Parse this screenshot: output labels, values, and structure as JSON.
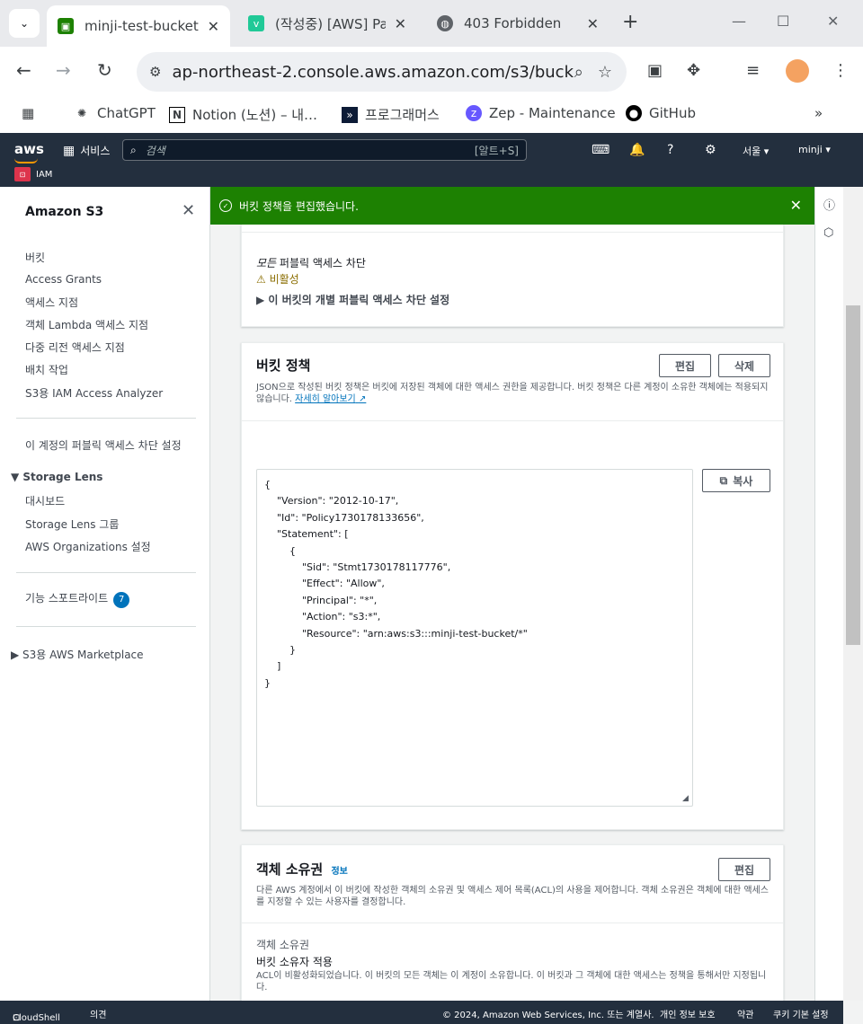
{
  "browser": {
    "tabs": [
      {
        "title": "minji-test-bucket -",
        "favicon_color": "#1d8102"
      },
      {
        "title": "(작성중) [AWS] Pa",
        "favicon_color": "#20c997",
        "favicon_letter": "v"
      },
      {
        "title": "403 Forbidden",
        "favicon_color": "#5f6368"
      }
    ],
    "url": "ap-northeast-2.console.aws.amazon.com/s3/buck…",
    "bookmarks": [
      "ChatGPT",
      "Notion (노션) – 내…",
      "프로그래머스",
      "Zep - Maintenance",
      "GitHub"
    ]
  },
  "aws_header": {
    "logo": "aws",
    "services_label": "서비스",
    "search_placeholder": "검색",
    "search_shortcut": "[알트+S]",
    "region": "서울 ▾",
    "user": "minji ▾",
    "favorite": "IAM"
  },
  "sidebar": {
    "title": "Amazon S3",
    "items": [
      "버킷",
      "Access Grants",
      "액세스 지점",
      "객체 Lambda 액세스 지점",
      "다중 리전 액세스 지점",
      "배치 작업",
      "S3용 IAM Access Analyzer"
    ],
    "public_block": "이 계정의 퍼블릭 액세스 차단 설정",
    "storage_lens": {
      "title": "Storage Lens",
      "items": [
        "대시보드",
        "Storage Lens 그룹",
        "AWS Organizations 설정"
      ]
    },
    "feature_spotlight": "기능 스포트라이트",
    "feature_count": "7",
    "marketplace": "S3용 AWS Marketplace"
  },
  "flash": {
    "message": "버킷 정책을 편집했습니다.",
    "color": "#1d8102"
  },
  "public_access": {
    "label_italic": "모든",
    "label_rest": " 퍼블릭 액세스 차단",
    "status": "비활성",
    "expand_label": "이 버킷의 개별 퍼블릭 액세스 차단 설정"
  },
  "bucket_policy": {
    "title": "버킷 정책",
    "edit": "편집",
    "delete": "삭제",
    "description": "JSON으로 작성된 버킷 정책은 버킷에 저장된 객체에 대한 액세스 권한을 제공합니다. 버킷 정책은 다른 계정이 소유한 객체에는 적용되지 않습니다. ",
    "learn_more": "자세히 알아보기",
    "copy": "복사",
    "policy_json": "{\n    \"Version\": \"2012-10-17\",\n    \"Id\": \"Policy1730178133656\",\n    \"Statement\": [\n        {\n            \"Sid\": \"Stmt1730178117776\",\n            \"Effect\": \"Allow\",\n            \"Principal\": \"*\",\n            \"Action\": \"s3:*\",\n            \"Resource\": \"arn:aws:s3:::minji-test-bucket/*\"\n        }\n    ]\n}"
  },
  "object_ownership": {
    "title": "객체 소유권",
    "info": "정보",
    "edit": "편집",
    "description": "다른 AWS 계정에서 이 버킷에 작성한 객체의 소유권 및 액세스 제어 목록(ACL)의 사용을 제어합니다. 객체 소유권은 객체에 대한 액세스를 지정할 수 있는 사용자를 결정합니다.",
    "label": "객체 소유권",
    "value": "버킷 소유자 적용",
    "note": "ACL이 비활성화되었습니다. 이 버킷의 모든 객체는 이 계정이 소유합니다. 이 버킷과 그 객체에 대한 액세스는 정책을 통해서만 지정됩니다."
  },
  "footer": {
    "cloudshell": "CloudShell",
    "feedback": "의견",
    "copyright": "© 2024, Amazon Web Services, Inc. 또는 계열사.",
    "privacy": "개인 정보 보호",
    "terms": "약관",
    "cookies": "쿠키 기본 설정"
  }
}
